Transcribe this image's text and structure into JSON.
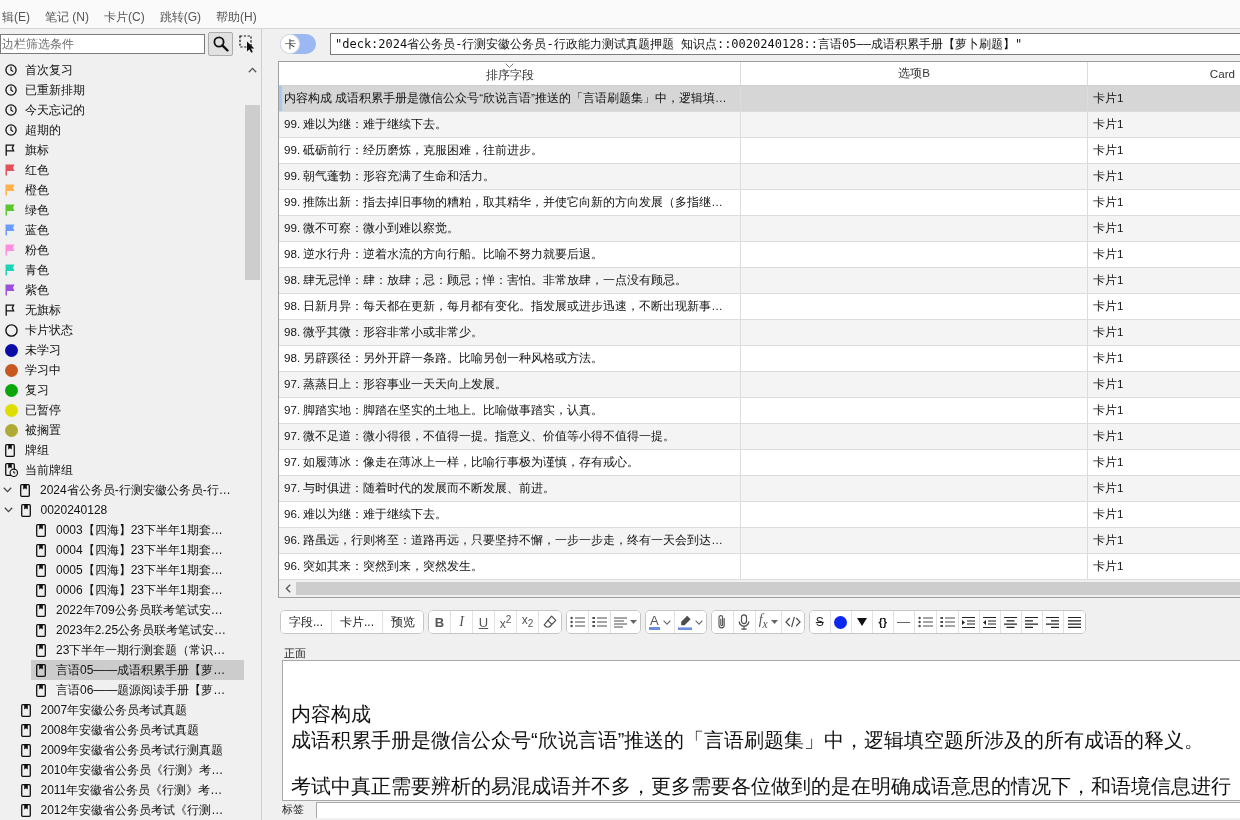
{
  "menu_bar": [
    "辑(E)",
    "笔记 (N)",
    "卡片(C)",
    "跳转(G)",
    "帮助(H)"
  ],
  "sidebar": {
    "filter": {
      "placeholder": "边栏筛选条件"
    },
    "tree": [
      {
        "children": [
          {
            "label": "首次复习",
            "kind": "clock",
            "selected": false
          },
          {
            "label": "已重新排期",
            "kind": "clock",
            "selected": false
          },
          {
            "label": "今天忘记的",
            "kind": "clock",
            "selected": false
          },
          {
            "label": "超期的",
            "kind": "clock",
            "selected": false
          }
        ]
      },
      {
        "label": "旗标",
        "kind": "flag",
        "selected": false,
        "children": [
          {
            "label": "红色",
            "kind": "flag",
            "color": "#e5505c",
            "selected": false
          },
          {
            "label": "橙色",
            "kind": "flag",
            "color": "#ffb04c",
            "selected": false
          },
          {
            "label": "绿色",
            "kind": "flag",
            "color": "#5cc62e",
            "selected": false
          },
          {
            "label": "蓝色",
            "kind": "flag",
            "color": "#6c9cff",
            "selected": false
          },
          {
            "label": "粉色",
            "kind": "flag",
            "color": "#ff8ee0",
            "selected": false
          },
          {
            "label": "青色",
            "kind": "flag",
            "color": "#1fd3b8",
            "selected": false
          },
          {
            "label": "紫色",
            "kind": "flag",
            "color": "#9a50dc",
            "selected": false
          },
          {
            "label": "无旗标",
            "kind": "flag",
            "selected": false
          }
        ]
      },
      {
        "label": "卡片状态",
        "kind": "state",
        "selected": false,
        "children": [
          {
            "label": "未学习",
            "kind": "dot",
            "color": "#0b0ba8",
            "selected": false
          },
          {
            "label": "学习中",
            "kind": "dot",
            "color": "#c8581f",
            "selected": false
          },
          {
            "label": "复习",
            "kind": "dot",
            "color": "#0aa60a",
            "selected": false
          },
          {
            "label": "已暂停",
            "kind": "dot",
            "color": "#dede00",
            "selected": false
          },
          {
            "label": "被搁置",
            "kind": "dot",
            "color": "#aeaa34",
            "selected": false
          }
        ]
      },
      {
        "label": "牌组",
        "kind": "deck",
        "selected": false,
        "children": [
          {
            "label": "当前牌组",
            "kind": "current-deck",
            "selected": false
          },
          {
            "label": "2024省公务员-行测安徽公务员-行…",
            "kind": "deck",
            "expanded": true,
            "selected": false,
            "children": [
              {
                "label": "0020240128",
                "kind": "deck",
                "expanded": true,
                "selected": false,
                "children": [
                  {
                    "label": "0003【四海】23下半年1期套…",
                    "kind": "deck",
                    "selected": false
                  },
                  {
                    "label": "0004【四海】23下半年1期套…",
                    "kind": "deck",
                    "selected": false
                  },
                  {
                    "label": "0005【四海】23下半年1期套…",
                    "kind": "deck",
                    "selected": false
                  },
                  {
                    "label": "0006【四海】23下半年1期套…",
                    "kind": "deck",
                    "selected": false
                  },
                  {
                    "label": "2022年709公务员联考笔试安…",
                    "kind": "deck",
                    "selected": false
                  },
                  {
                    "label": "2023年2.25公务员联考笔试安…",
                    "kind": "deck",
                    "selected": false
                  },
                  {
                    "label": "23下半年一期行测套题（常识…",
                    "kind": "deck",
                    "selected": false
                  },
                  {
                    "label": "言语05——成语积累手册【萝…",
                    "kind": "deck",
                    "selected": true
                  },
                  {
                    "label": "言语06——题源阅读手册【萝…",
                    "kind": "deck",
                    "selected": false
                  }
                ]
              },
              {
                "label": "2007年安徽公务员考试真题",
                "kind": "deck",
                "selected": false
              },
              {
                "label": "2008年安徽省公务员考试真题",
                "kind": "deck",
                "selected": false
              },
              {
                "label": "2009年安徽省公务员考试行测真题",
                "kind": "deck",
                "selected": false
              },
              {
                "label": "2010年安徽省公务员《行测》考…",
                "kind": "deck",
                "selected": false
              },
              {
                "label": "2011年安徽省公务员《行测》考…",
                "kind": "deck",
                "selected": false
              },
              {
                "label": "2012年安徽省公务员考试《行测…",
                "kind": "deck",
                "selected": false
              }
            ]
          }
        ]
      }
    ]
  },
  "main": {
    "mode_switch": {
      "label": "卡",
      "on": false
    },
    "search": {
      "value": "\"deck:2024省公务员-行测安徽公务员-行政能力测试真题押题 知识点::0020240128::言语05——成语积累手册【萝卜刷题】\""
    },
    "table": {
      "columns": [
        {
          "label": "排序字段",
          "sorted": true
        },
        {
          "label": "选项B",
          "sorted": false
        },
        {
          "label": "Card",
          "sorted": false
        }
      ],
      "rows": [
        {
          "sort_field": "内容构成 成语积累手册是微信公众号“欣说言语”推送的「言语刷题集」中，逻辑填…",
          "card": "卡片1",
          "selected": true
        },
        {
          "sort_field": "99. 难以为继：难于继续下去。",
          "card": "卡片1",
          "selected": false
        },
        {
          "sort_field": "99. 砥砺前行：经历磨炼，克服困难，往前进步。",
          "card": "卡片1",
          "selected": false
        },
        {
          "sort_field": "99. 朝气蓬勃：形容充满了生命和活力。",
          "card": "卡片1",
          "selected": false
        },
        {
          "sort_field": "99. 推陈出新：指去掉旧事物的糟粕，取其精华，并使它向新的方向发展（多指继…",
          "card": "卡片1",
          "selected": false
        },
        {
          "sort_field": "99. 微不可察：微小到难以察觉。",
          "card": "卡片1",
          "selected": false
        },
        {
          "sort_field": "98. 逆水行舟：逆着水流的方向行船。比喻不努力就要后退。",
          "card": "卡片1",
          "selected": false
        },
        {
          "sort_field": "98. 肆无忌惮：肆：放肆；忌：顾忌；惮：害怕。非常放肆，一点没有顾忌。",
          "card": "卡片1",
          "selected": false
        },
        {
          "sort_field": "98. 日新月异：每天都在更新，每月都有变化。指发展或进步迅速，不断出现新事…",
          "card": "卡片1",
          "selected": false
        },
        {
          "sort_field": "98. 微乎其微：形容非常小或非常少。",
          "card": "卡片1",
          "selected": false
        },
        {
          "sort_field": "98. 另辟蹊径：另外开辟一条路。比喻另创一种风格或方法。",
          "card": "卡片1",
          "selected": false
        },
        {
          "sort_field": "97. 蒸蒸日上：形容事业一天天向上发展。",
          "card": "卡片1",
          "selected": false
        },
        {
          "sort_field": "97. 脚踏实地：脚踏在坚实的土地上。比喻做事踏实，认真。",
          "card": "卡片1",
          "selected": false
        },
        {
          "sort_field": "97. 微不足道：微小得很，不值得一提。指意义、价值等小得不值得一提。",
          "card": "卡片1",
          "selected": false
        },
        {
          "sort_field": "97. 如履薄冰：像走在薄冰上一样，比喻行事极为谨慎，存有戒心。",
          "card": "卡片1",
          "selected": false
        },
        {
          "sort_field": "97. 与时俱进：随着时代的发展而不断发展、前进。",
          "card": "卡片1",
          "selected": false
        },
        {
          "sort_field": "96. 难以为继：难于继续下去。",
          "card": "卡片1",
          "selected": false
        },
        {
          "sort_field": "96. 路虽远，行则将至：道路再远，只要坚持不懈，一步一步走，终有一天会到达…",
          "card": "卡片1",
          "selected": false
        },
        {
          "sort_field": "96. 突如其来：突然到来，突然发生。",
          "card": "卡片1",
          "selected": false
        }
      ]
    }
  },
  "editor": {
    "toolbar": [
      {
        "items": [
          {
            "kind": "text",
            "label": "字段..."
          },
          {
            "kind": "text",
            "label": "卡片..."
          },
          {
            "kind": "text",
            "label": "预览"
          }
        ]
      },
      {
        "items": [
          {
            "kind": "bold",
            "label": "B"
          },
          {
            "kind": "italic",
            "label": "I"
          },
          {
            "kind": "underline",
            "label": "U"
          },
          {
            "kind": "superscript",
            "label": "x$^{2}$"
          },
          {
            "kind": "subscript",
            "label": "x$_{2}$"
          },
          {
            "kind": "eraser"
          }
        ]
      },
      {
        "items": [
          {
            "kind": "bullets"
          },
          {
            "kind": "numbers"
          },
          {
            "kind": "align",
            "menu": true
          }
        ]
      },
      {
        "items": [
          {
            "kind": "text-color",
            "label": "A",
            "menu": true
          },
          {
            "kind": "highlight",
            "menu": true
          }
        ]
      },
      {
        "items": [
          {
            "kind": "paperclip"
          },
          {
            "kind": "mic"
          },
          {
            "kind": "formula",
            "label": "f$_{x}$",
            "menu": true
          },
          {
            "kind": "code"
          }
        ]
      },
      {
        "items": [
          {
            "kind": "strike",
            "label": "S"
          },
          {
            "kind": "dot"
          },
          {
            "kind": "triangle"
          },
          {
            "kind": "symbol",
            "label": "{}"
          },
          {
            "kind": "rule"
          },
          {
            "kind": "bullets"
          },
          {
            "kind": "numbers"
          },
          {
            "kind": "indent"
          },
          {
            "kind": "outdent"
          },
          {
            "kind": "center"
          },
          {
            "kind": "left"
          },
          {
            "kind": "right"
          },
          {
            "kind": "justify"
          }
        ]
      }
    ],
    "field": {
      "label": "正面",
      "paragraphs": [
        [
          "内容构成",
          "成语积累手册是微信公众号“欣说言语”推送的「言语刷题集」中，逻辑填空题所涉及的所有成语的释义。"
        ],
        [
          "考试中真正需要辨析的易混成语并不多，更多需要各位做到的是在明确成语意思的情况下，和语境信息进行"
        ]
      ]
    },
    "tags": {
      "label": "标签"
    }
  }
}
